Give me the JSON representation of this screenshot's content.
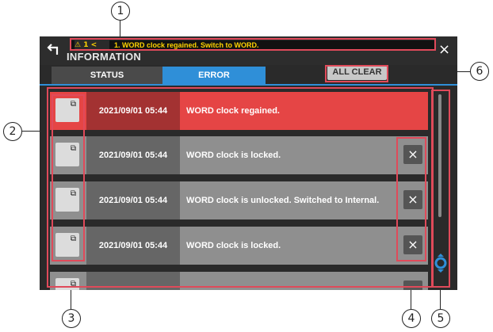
{
  "callouts": [
    "1",
    "2",
    "3",
    "4",
    "5",
    "6"
  ],
  "screen": {
    "title": "INFORMATION",
    "back_icon": "back-arrow-icon",
    "close_label": "×",
    "alert": {
      "warn": "⚠ 1 <",
      "text": "1. WORD clock regained. Switch to WORD."
    },
    "tabs": [
      {
        "label": "STATUS"
      },
      {
        "label": "ERROR"
      }
    ],
    "clear_label": "ALL CLEAR",
    "rows": [
      {
        "time": "2021/09/01 05:44",
        "message": "WORD clock regained."
      },
      {
        "time": "2021/09/01 05:44",
        "message": "WORD clock is locked."
      },
      {
        "time": "2021/09/01 05:44",
        "message": "WORD clock is unlocked. Switched to Internal."
      },
      {
        "time": "2021/09/01 05:44",
        "message": "WORD clock is locked."
      }
    ],
    "delete_label": "×",
    "popout_icon": "⧉"
  },
  "colors": {
    "error_row": "#e54545",
    "accent": "#2f8fd8",
    "highlight": "#e04a5a"
  }
}
